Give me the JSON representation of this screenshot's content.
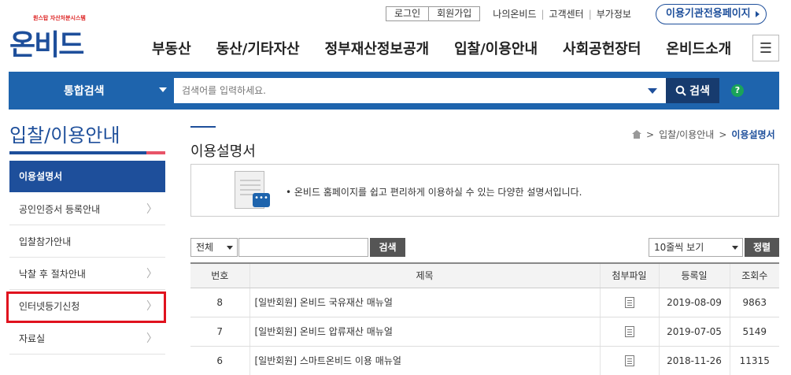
{
  "header": {
    "logo_tag": "원스탑 자산처분시스템",
    "logo_text": "온비드",
    "login": "로그인",
    "join": "회원가입",
    "links": [
      "나의온비드",
      "고객센터",
      "부가정보"
    ],
    "org_page": "이용기관전용페이지"
  },
  "gnb": [
    "부동산",
    "동산/기타자산",
    "정부재산정보공개",
    "입찰/이용안내",
    "사회공헌장터",
    "온비드소개"
  ],
  "search": {
    "label": "통합검색",
    "placeholder": "검색어를 입력하세요.",
    "button": "검색",
    "help": "?"
  },
  "sidebar": {
    "title": "입찰/이용안내",
    "items": [
      {
        "label": "이용설명서"
      },
      {
        "label": "공인인증서 등록안내"
      },
      {
        "label": "입찰참가안내"
      },
      {
        "label": "낙찰 후 절차안내"
      },
      {
        "label": "인터넷등기신청"
      },
      {
        "label": "자료실"
      }
    ]
  },
  "content": {
    "title": "이용설명서",
    "breadcrumb": [
      "입찰/이용안내",
      "이용설명서"
    ],
    "info_text": "• 온비드 홈페이지를 쉽고 편리하게 이용하실 수 있는 다양한 설명서입니다.",
    "filter_select": "전체",
    "filter_button": "검색",
    "rows_select": "10줄씩 보기",
    "sort_button": "정렬",
    "columns": [
      "번호",
      "제목",
      "첨부파일",
      "등록일",
      "조회수"
    ],
    "rows": [
      {
        "no": "8",
        "title": "[일반회원] 온비드 국유재산 매뉴얼",
        "date": "2019-08-09",
        "views": "9863"
      },
      {
        "no": "7",
        "title": "[일반회원] 온비드 압류재산 매뉴얼",
        "date": "2019-07-05",
        "views": "5149"
      },
      {
        "no": "6",
        "title": "[일반회원] 스마트온비드 이용 매뉴얼",
        "date": "2018-11-26",
        "views": "11315"
      }
    ]
  },
  "colors": {
    "brand": "#1e4f9b",
    "search_bar": "#1e64ad",
    "highlight": "#e0121e"
  }
}
